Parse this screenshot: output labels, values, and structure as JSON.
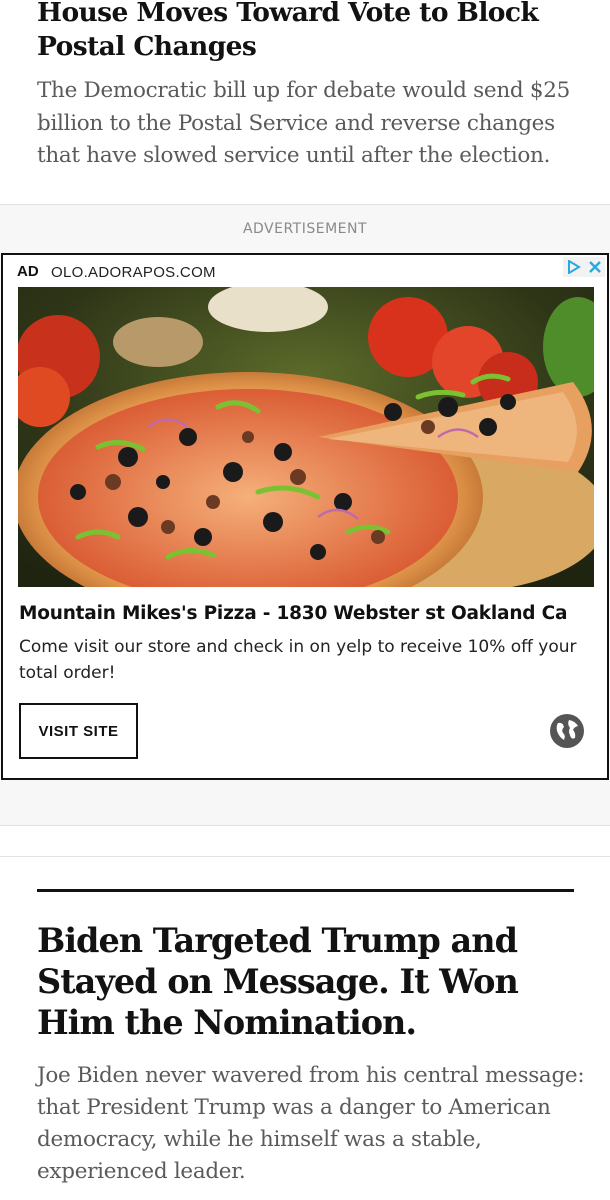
{
  "top_story": {
    "headline": "House Moves Toward Vote to Block Postal Changes",
    "summary": "The Democratic bill up for debate would send $25 billion to the Postal Service and reverse changes that have slowed service until after the election."
  },
  "advertisement": {
    "label": "ADVERTISEMENT",
    "tag": "AD",
    "domain": "OLO.ADORAPOS.COM",
    "image": "pizza-photo",
    "title": "Mountain Mikes's Pizza - 1830 Webster st Oakland Ca",
    "body": "Come visit our store and check in on yelp to receive 10% off your total order!",
    "cta_label": "VISIT SITE",
    "icons": [
      "adchoices-icon",
      "close-icon",
      "globe-icon"
    ],
    "colors": {
      "adchoices": "#2aa9e0",
      "border": "#111111"
    }
  },
  "second_story": {
    "headline": "Biden Targeted Trump and Stayed on Message. It Won Him the Nomination.",
    "summary": "Joe Biden never wavered from his central message: that President Trump was a danger to American democracy, while he himself was a stable, experienced leader."
  }
}
